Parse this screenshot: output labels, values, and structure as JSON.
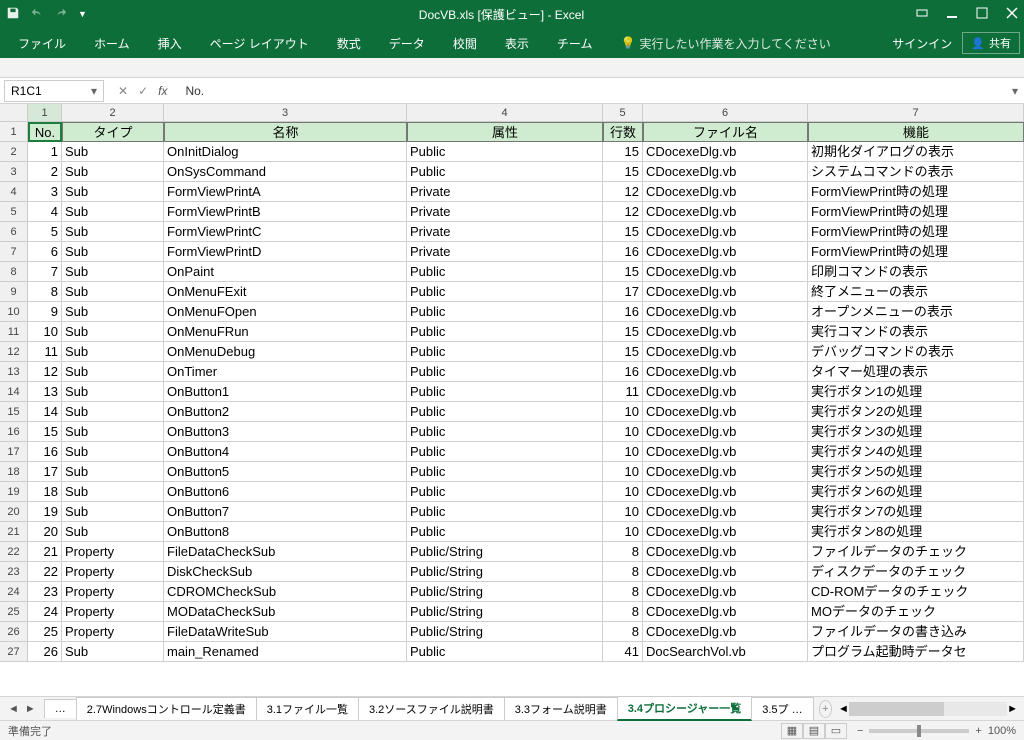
{
  "title": "DocVB.xls  [保護ビュー] - Excel",
  "ribbon": {
    "file": "ファイル",
    "home": "ホーム",
    "insert": "挿入",
    "layout": "ページ レイアウト",
    "formulas": "数式",
    "data": "データ",
    "review": "校閲",
    "view": "表示",
    "team": "チーム",
    "tellme": "実行したい作業を入力してください",
    "signin": "サインイン",
    "share": "共有"
  },
  "namebox": "R1C1",
  "formula": "No.",
  "colnums": [
    "1",
    "2",
    "3",
    "4",
    "5",
    "6",
    "7"
  ],
  "headers": [
    "No.",
    "タイプ",
    "名称",
    "属性",
    "行数",
    "ファイル名",
    "機能"
  ],
  "rows": [
    [
      "1",
      "Sub",
      "OnInitDialog",
      "Public",
      "15",
      "CDocexeDlg.vb",
      "初期化ダイアログの表示"
    ],
    [
      "2",
      "Sub",
      "OnSysCommand",
      "Public",
      "15",
      "CDocexeDlg.vb",
      "システムコマンドの表示"
    ],
    [
      "3",
      "Sub",
      "FormViewPrintA",
      "Private",
      "12",
      "CDocexeDlg.vb",
      "FormViewPrint時の処理"
    ],
    [
      "4",
      "Sub",
      "FormViewPrintB",
      "Private",
      "12",
      "CDocexeDlg.vb",
      "FormViewPrint時の処理"
    ],
    [
      "5",
      "Sub",
      "FormViewPrintC",
      "Private",
      "15",
      "CDocexeDlg.vb",
      "FormViewPrint時の処理"
    ],
    [
      "6",
      "Sub",
      "FormViewPrintD",
      "Private",
      "16",
      "CDocexeDlg.vb",
      "FormViewPrint時の処理"
    ],
    [
      "7",
      "Sub",
      "OnPaint",
      "Public",
      "15",
      "CDocexeDlg.vb",
      "印刷コマンドの表示"
    ],
    [
      "8",
      "Sub",
      "OnMenuFExit",
      "Public",
      "17",
      "CDocexeDlg.vb",
      "終了メニューの表示"
    ],
    [
      "9",
      "Sub",
      "OnMenuFOpen",
      "Public",
      "16",
      "CDocexeDlg.vb",
      "オープンメニューの表示"
    ],
    [
      "10",
      "Sub",
      "OnMenuFRun",
      "Public",
      "15",
      "CDocexeDlg.vb",
      "実行コマンドの表示"
    ],
    [
      "11",
      "Sub",
      "OnMenuDebug",
      "Public",
      "15",
      "CDocexeDlg.vb",
      "デバッグコマンドの表示"
    ],
    [
      "12",
      "Sub",
      "OnTimer",
      "Public",
      "16",
      "CDocexeDlg.vb",
      "タイマー処理の表示"
    ],
    [
      "13",
      "Sub",
      "OnButton1",
      "Public",
      "11",
      "CDocexeDlg.vb",
      "実行ボタン1の処理"
    ],
    [
      "14",
      "Sub",
      "OnButton2",
      "Public",
      "10",
      "CDocexeDlg.vb",
      "実行ボタン2の処理"
    ],
    [
      "15",
      "Sub",
      "OnButton3",
      "Public",
      "10",
      "CDocexeDlg.vb",
      "実行ボタン3の処理"
    ],
    [
      "16",
      "Sub",
      "OnButton4",
      "Public",
      "10",
      "CDocexeDlg.vb",
      "実行ボタン4の処理"
    ],
    [
      "17",
      "Sub",
      "OnButton5",
      "Public",
      "10",
      "CDocexeDlg.vb",
      "実行ボタン5の処理"
    ],
    [
      "18",
      "Sub",
      "OnButton6",
      "Public",
      "10",
      "CDocexeDlg.vb",
      "実行ボタン6の処理"
    ],
    [
      "19",
      "Sub",
      "OnButton7",
      "Public",
      "10",
      "CDocexeDlg.vb",
      "実行ボタン7の処理"
    ],
    [
      "20",
      "Sub",
      "OnButton8",
      "Public",
      "10",
      "CDocexeDlg.vb",
      "実行ボタン8の処理"
    ],
    [
      "21",
      "Property",
      "FileDataCheckSub",
      "Public/String",
      "8",
      "CDocexeDlg.vb",
      "ファイルデータのチェック"
    ],
    [
      "22",
      "Property",
      "DiskCheckSub",
      "Public/String",
      "8",
      "CDocexeDlg.vb",
      "ディスクデータのチェック"
    ],
    [
      "23",
      "Property",
      "CDROMCheckSub",
      "Public/String",
      "8",
      "CDocexeDlg.vb",
      "CD-ROMデータのチェック"
    ],
    [
      "24",
      "Property",
      "MODataCheckSub",
      "Public/String",
      "8",
      "CDocexeDlg.vb",
      "MOデータのチェック"
    ],
    [
      "25",
      "Property",
      "FileDataWriteSub",
      "Public/String",
      "8",
      "CDocexeDlg.vb",
      "ファイルデータの書き込み"
    ],
    [
      "26",
      "Sub",
      "main_Renamed",
      "Public",
      "41",
      "DocSearchVol.vb",
      "プログラム起動時データセ"
    ]
  ],
  "tabs": {
    "more": "…",
    "t1": "2.7Windowsコントロール定義書",
    "t2": "3.1ファイル一覧",
    "t3": "3.2ソースファイル説明書",
    "t4": "3.3フォーム説明書",
    "t5": "3.4プロシージャー一覧",
    "t6": "3.5プ …"
  },
  "status": "準備完了",
  "zoom": "100%"
}
